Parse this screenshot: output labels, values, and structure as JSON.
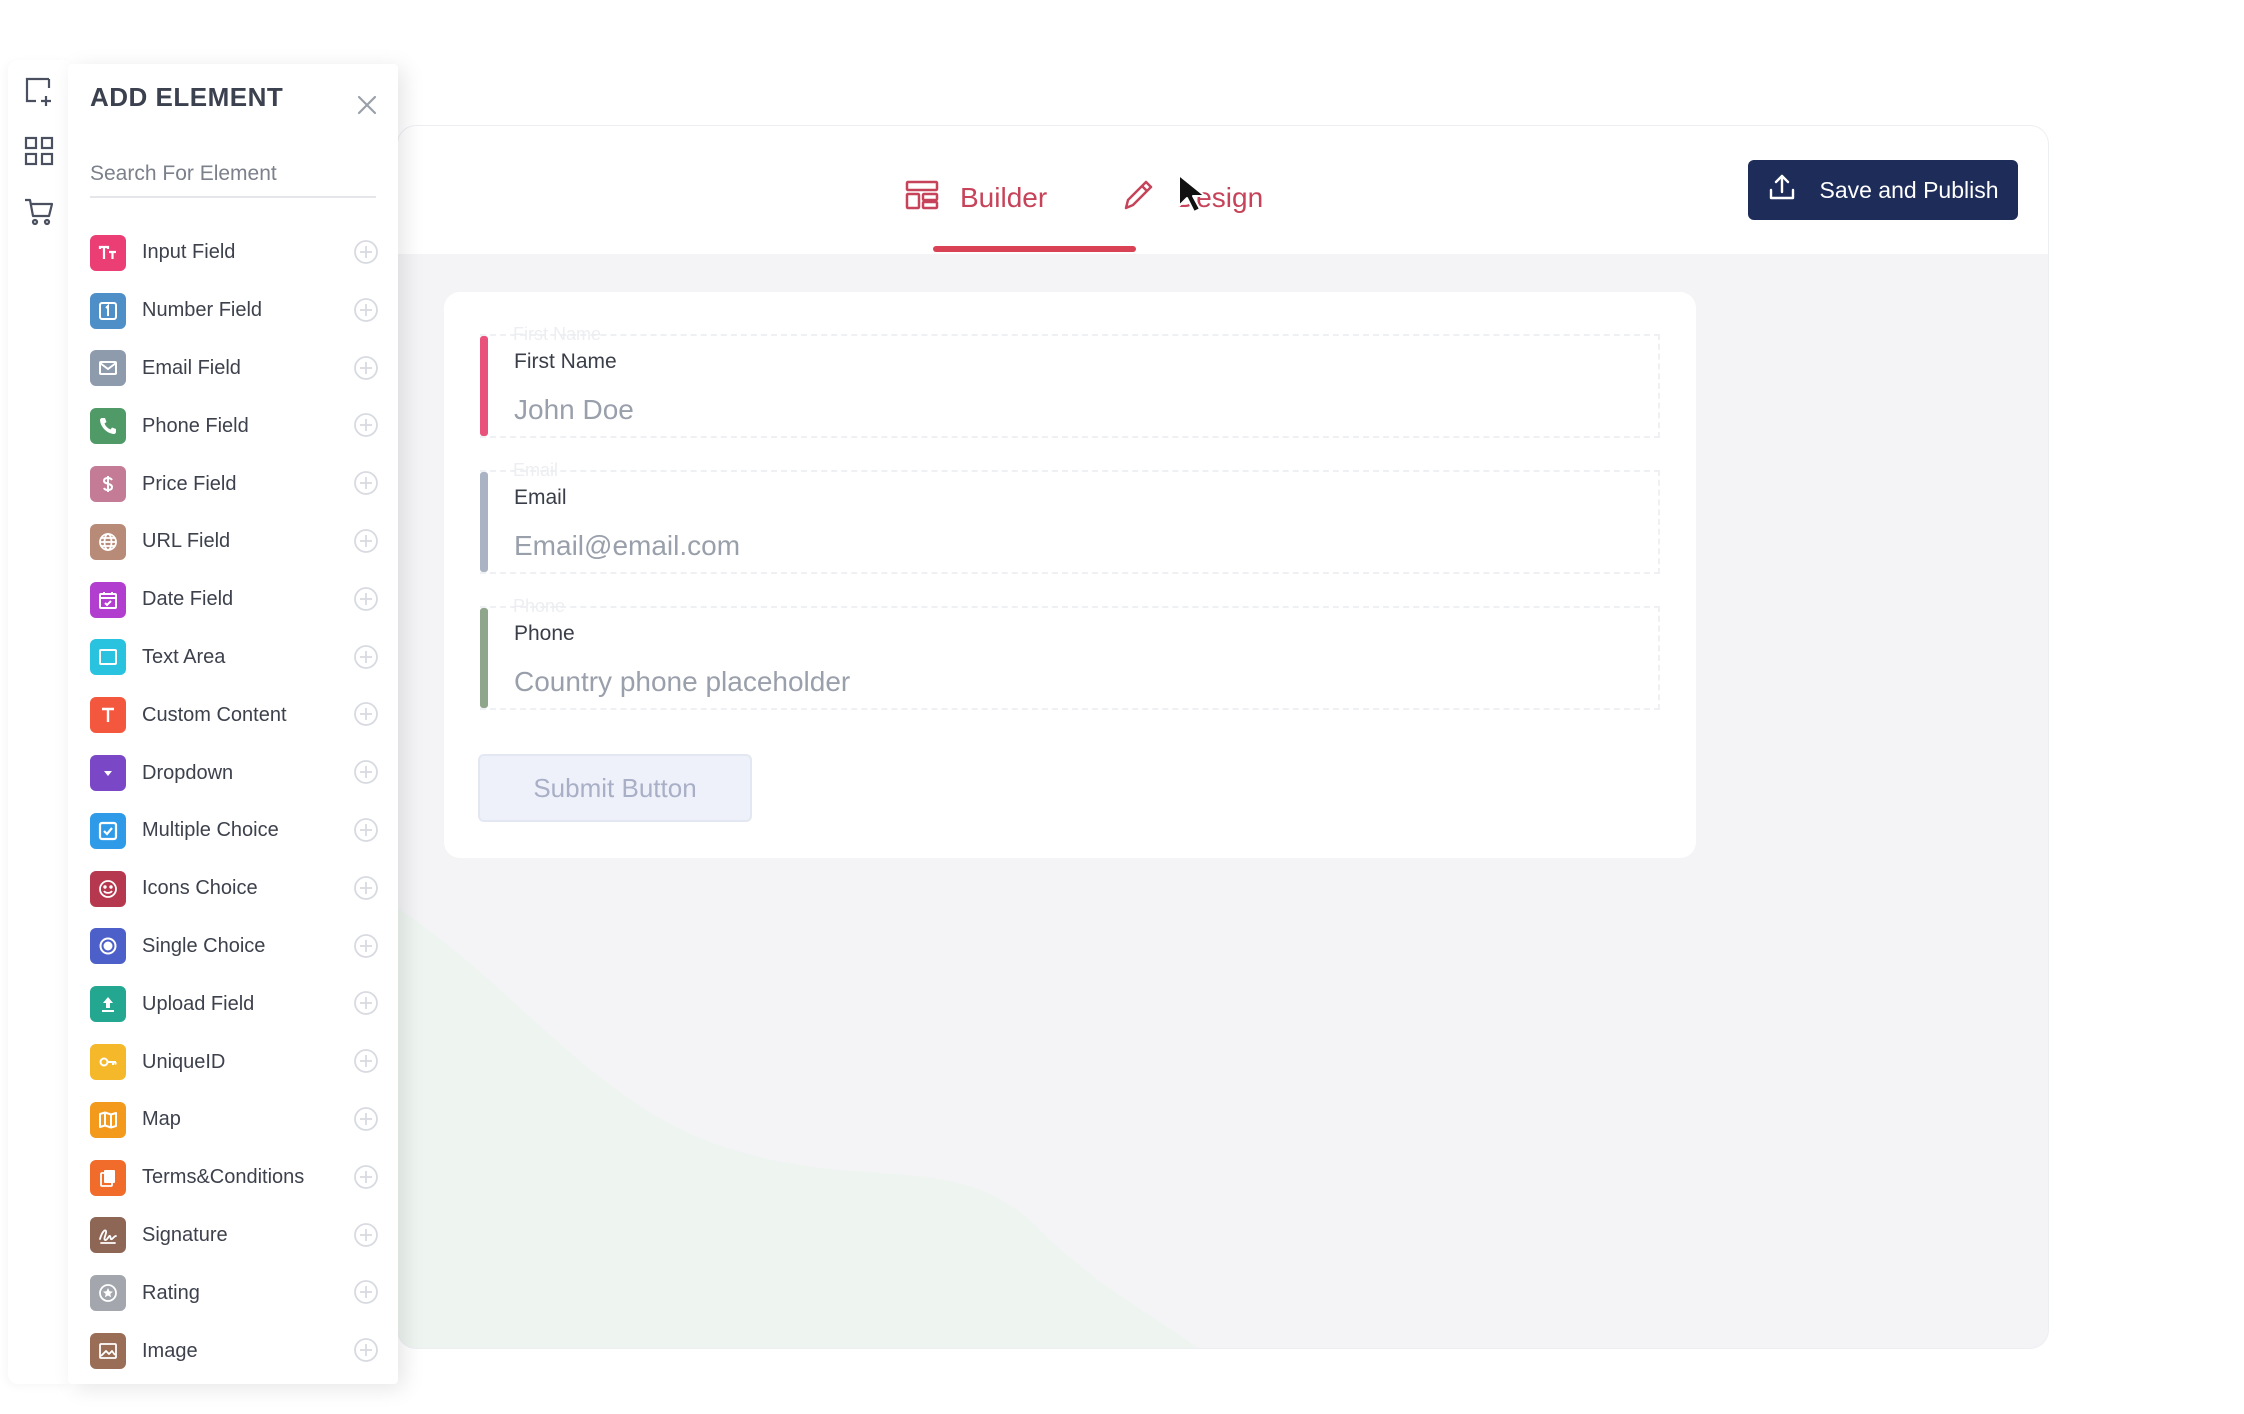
{
  "header": {
    "tabs": [
      {
        "label": "Builder",
        "active": true,
        "icon": "layout-icon"
      },
      {
        "label": "Design",
        "active": false,
        "icon": "pencil-icon"
      }
    ],
    "publish_label": "Save and Publish",
    "accent_color": "#d94155",
    "publish_color": "#1e2c5a"
  },
  "panel": {
    "title": "ADD ELEMENT",
    "search_placeholder": "Search For Element",
    "items": [
      {
        "label": "Input Field",
        "icon": "text-input-icon",
        "color": "#ea3e74"
      },
      {
        "label": "Number Field",
        "icon": "number-icon",
        "color": "#4f8fc8"
      },
      {
        "label": "Email Field",
        "icon": "envelope-icon",
        "color": "#8d9bac"
      },
      {
        "label": "Phone Field",
        "icon": "phone-icon",
        "color": "#4f9a67"
      },
      {
        "label": "Price Field",
        "icon": "dollar-icon",
        "color": "#c47b96"
      },
      {
        "label": "URL Field",
        "icon": "globe-icon",
        "color": "#b88a78"
      },
      {
        "label": "Date Field",
        "icon": "calendar-icon",
        "color": "#b23ed0"
      },
      {
        "label": "Text Area",
        "icon": "textarea-icon",
        "color": "#29c3e0"
      },
      {
        "label": "Custom Content",
        "icon": "text-t-icon",
        "color": "#f3573d"
      },
      {
        "label": "Dropdown",
        "icon": "dropdown-icon",
        "color": "#7a48c7"
      },
      {
        "label": "Multiple Choice",
        "icon": "checkbox-icon",
        "color": "#2f9be8"
      },
      {
        "label": "Icons Choice",
        "icon": "smiley-icon",
        "color": "#b6384e"
      },
      {
        "label": "Single Choice",
        "icon": "radio-icon",
        "color": "#4d5fc8"
      },
      {
        "label": "Upload Field",
        "icon": "upload-icon",
        "color": "#23a790"
      },
      {
        "label": "UniqueID",
        "icon": "key-icon",
        "color": "#f5b82b"
      },
      {
        "label": "Map",
        "icon": "map-icon",
        "color": "#f39a1c"
      },
      {
        "label": "Terms&Conditions",
        "icon": "document-icon",
        "color": "#f16b2b"
      },
      {
        "label": "Signature",
        "icon": "signature-icon",
        "color": "#8d6656"
      },
      {
        "label": "Rating",
        "icon": "star-icon",
        "color": "#a3a7ad"
      },
      {
        "label": "Image",
        "icon": "image-icon",
        "color": "#9a6d56"
      }
    ]
  },
  "form": {
    "fields": [
      {
        "label": "First Name",
        "placeholder": "John Doe",
        "color": "#e9527a"
      },
      {
        "label": "Email",
        "placeholder": "Email@email.com",
        "color": "#aab3c4"
      },
      {
        "label": "Phone",
        "placeholder": "Country phone placeholder",
        "color": "#8fa58c"
      }
    ],
    "submit_label": "Submit Button"
  }
}
